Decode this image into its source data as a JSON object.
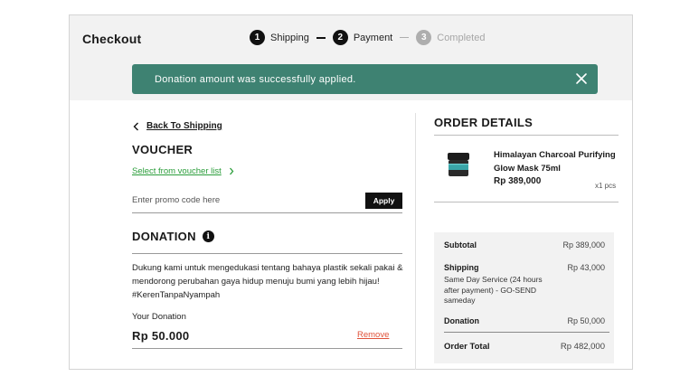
{
  "page": {
    "title": "Checkout"
  },
  "steps": [
    {
      "number": "1",
      "label": "Shipping",
      "state": "done"
    },
    {
      "number": "2",
      "label": "Payment",
      "state": "active"
    },
    {
      "number": "3",
      "label": "Completed",
      "state": "inactive"
    }
  ],
  "alert": {
    "message": "Donation amount was successfully applied.",
    "close_icon": "close-icon",
    "color": "#3e8272"
  },
  "back": {
    "label": "Back To Shipping",
    "icon": "chevron-left-icon"
  },
  "voucher": {
    "title": "VOUCHER",
    "select_link": "Select from voucher list",
    "promo_placeholder": "Enter promo code here",
    "apply_label": "Apply"
  },
  "donation": {
    "title": "DONATION",
    "info_icon": "info-icon",
    "description": "Dukung kami untuk mengedukasi tentang bahaya plastik sekali pakai & mendorong perubahan gaya hidup menuju bumi yang lebih hijau! #KerenTanpaNyampah",
    "your_donation_label": "Your Donation",
    "amount": "Rp 50.000",
    "remove_label": "Remove"
  },
  "order": {
    "title": "ORDER DETAILS",
    "product": {
      "name": "Himalayan Charcoal Purifying Glow Mask 75ml",
      "price": "Rp 389,000",
      "quantity": "x1 pcs"
    },
    "summary": {
      "subtotal_label": "Subtotal",
      "subtotal_value": "Rp 389,000",
      "shipping_label": "Shipping",
      "shipping_value": "Rp 43,000",
      "shipping_desc": "Same Day Service (24 hours after payment) - GO-SEND sameday",
      "donation_label": "Donation",
      "donation_value": "Rp 50,000",
      "total_label": "Order Total",
      "total_value": "Rp 482,000"
    }
  },
  "colors": {
    "success": "#3e8272",
    "link": "#2a9d3a",
    "remove": "#e0523a"
  }
}
